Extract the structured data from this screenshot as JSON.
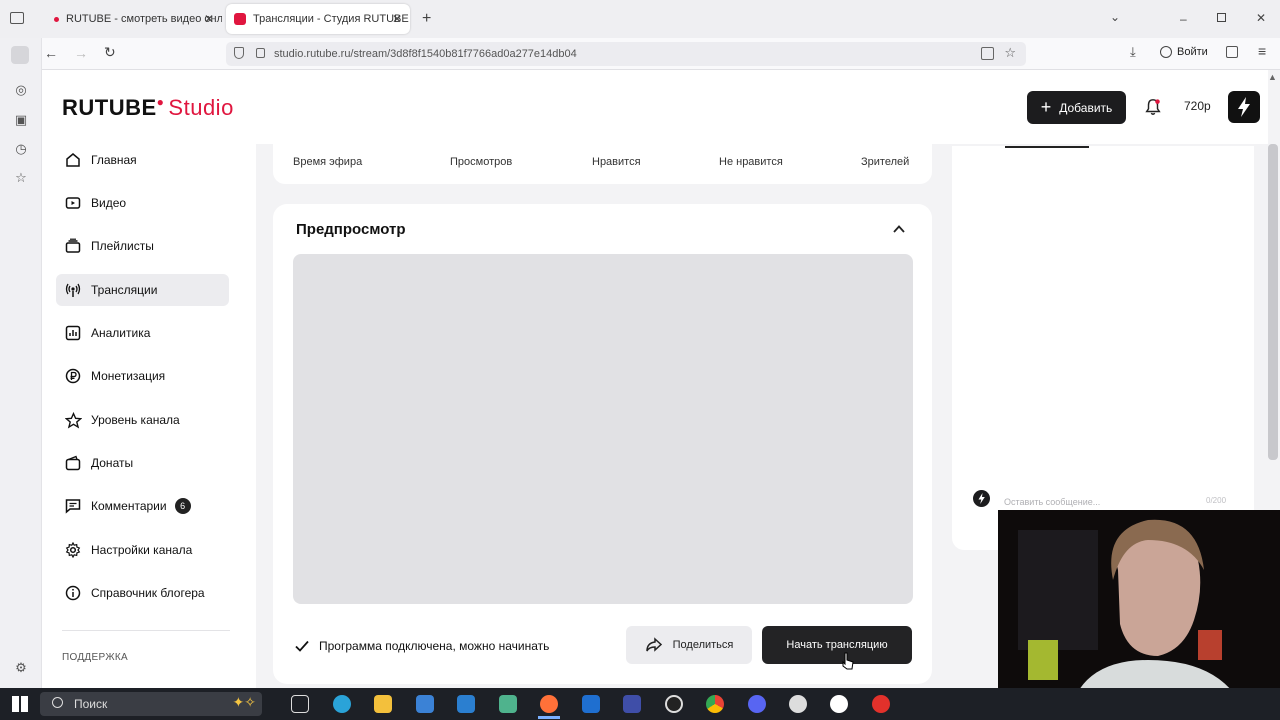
{
  "browser": {
    "tabs": [
      {
        "label": "RUTUBE - смотреть видео онл",
        "active": false
      },
      {
        "label": "Трансляции - Студия RUTUBE",
        "active": true
      }
    ],
    "url": "studio.rutube.ru/stream/3d8f8f1540b81f7766ad0a277e14db04",
    "login_label": "Войти"
  },
  "header": {
    "logo_main": "RUTUBE",
    "logo_sub": "Studio",
    "add_label": "Добавить",
    "quality": "720p"
  },
  "nav": {
    "items": [
      {
        "label": "Главная",
        "icon": "home-icon"
      },
      {
        "label": "Видео",
        "icon": "video-icon"
      },
      {
        "label": "Плейлисты",
        "icon": "playlist-icon"
      },
      {
        "label": "Трансляции",
        "icon": "broadcast-icon",
        "active": true
      },
      {
        "label": "Аналитика",
        "icon": "analytics-icon"
      },
      {
        "label": "Монетизация",
        "icon": "ruble-icon"
      },
      {
        "label": "Уровень канала",
        "icon": "star-icon"
      },
      {
        "label": "Донаты",
        "icon": "wallet-icon"
      },
      {
        "label": "Комментарии",
        "icon": "comment-icon",
        "badge": "6"
      },
      {
        "label": "Настройки канала",
        "icon": "gear-icon"
      },
      {
        "label": "Справочник блогера",
        "icon": "info-icon"
      }
    ],
    "support_label": "ПОДДЕРЖКА"
  },
  "stats": {
    "labels": [
      "Время эфира",
      "Просмотров",
      "Нравится",
      "Не нравится",
      "Зрителей"
    ]
  },
  "preview": {
    "title": "Предпросмотр",
    "status": "Программа подключена, можно начинать",
    "share_label": "Поделиться",
    "start_label": "Начать трансляцию"
  },
  "chat": {
    "placeholder": "Оставить сообщение...",
    "counter": "0/200"
  },
  "taskbar": {
    "search_label": "Поиск"
  },
  "colors": {
    "brand": "#e0163f",
    "dark_button": "#232325",
    "background": "#f3f3f5"
  }
}
